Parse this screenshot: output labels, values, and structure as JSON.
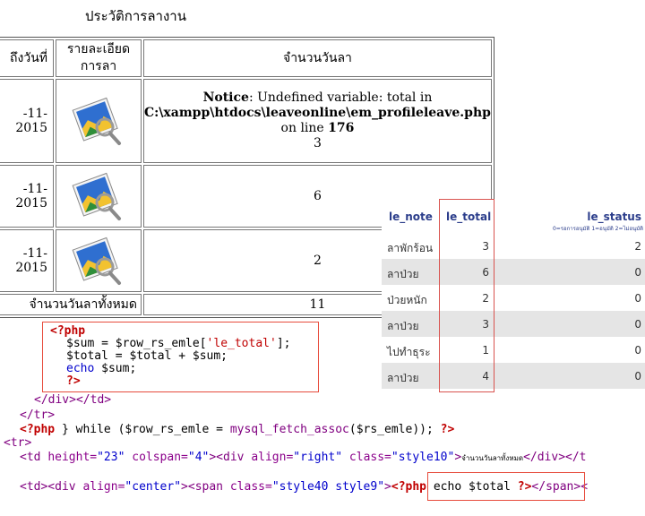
{
  "page": {
    "title": "ประวัติการลางาน"
  },
  "leave_table": {
    "headers": [
      "ถึงวันที่",
      "รายละเอียด\nการลา",
      "จำนวนวันลา"
    ],
    "header_col2_line1": "รายละเอียด",
    "header_col2_line2": "การลา",
    "rows": [
      {
        "date": "-11-2015",
        "days": "3"
      },
      {
        "date": "-11-2015",
        "days": "6"
      },
      {
        "date": "-11-2015",
        "days": "2"
      }
    ],
    "notice": {
      "label": "Notice",
      "text": ": Undefined variable: total in",
      "path": "C:\\xampp\\htdocs\\leaveonline\\em_profileleave.php",
      "on_line": "on line ",
      "line_no": "176"
    },
    "total_label": "จำนวนวันลาทั้งหมด",
    "total_value": "11"
  },
  "db_panel": {
    "columns": [
      "le_note",
      "le_total",
      "le_status"
    ],
    "status_hint": "0=รอการอนุมัติ 1=อนุมัติ 2=ไม่อนุมัติ",
    "rows": [
      {
        "note": "ลาพักร้อน",
        "total": "3",
        "status": "2"
      },
      {
        "note": "ลาป่วย",
        "total": "6",
        "status": "0"
      },
      {
        "note": "ป่วยหนัก",
        "total": "2",
        "status": "0"
      },
      {
        "note": "ลาป่วย",
        "total": "3",
        "status": "0"
      },
      {
        "note": "ไปทำธุระ",
        "total": "1",
        "status": "0"
      },
      {
        "note": "ลาป่วย",
        "total": "4",
        "status": "0"
      }
    ]
  },
  "code": {
    "l1": "<?php",
    "l2a": "$sum = $row_rs_emle[",
    "l2b": "'le_total'",
    "l2c": "];",
    "l3": "$total = $total + $sum;",
    "l4a": "echo",
    "l4b": " $sum;",
    "l5": "?>",
    "l6": "</div></td>",
    "l7": "</tr>",
    "l8a": "<?php",
    "l8b": " } while ($row_rs_emle = ",
    "l8c": "mysql_fetch_assoc",
    "l8d": "($rs_emle)); ",
    "l8e": "?>",
    "l9": "<tr>",
    "l10a": "<td ",
    "l10b": "height=",
    "l10c": "\"23\"",
    "l10d": " colspan=",
    "l10e": "\"4\"",
    "l10f": "><div ",
    "l10g": "align=",
    "l10h": "\"right\"",
    "l10i": " class=",
    "l10j": "\"style10\"",
    "l10k": ">",
    "l10l": "จำนวนวันลาทั้งหมด",
    "l10m": "</div></t",
    "l11a": "<td><div ",
    "l11b": "align=",
    "l11c": "\"center\"",
    "l11d": "><span ",
    "l11e": "class=",
    "l11f": "\"style40 style9\"",
    "l11g": ">",
    "l11h": "<?php",
    "l11i": " echo $total ",
    "l11j": "?>",
    "l11k": "</span><"
  },
  "colors": {
    "php_red": "#c00000",
    "tag_purple": "#800080",
    "value_blue": "#0000cc",
    "highlight_red": "#e74c3c",
    "db_header_blue": "#2b3d8b"
  }
}
